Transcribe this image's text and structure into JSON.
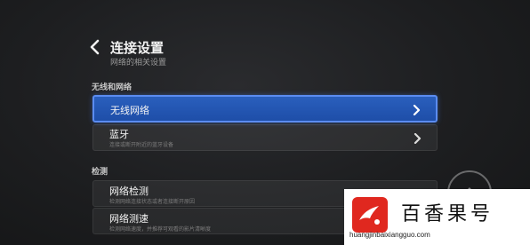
{
  "header": {
    "back_icon": "chevron-left-icon",
    "title": "连接设置",
    "subtitle": "网络的相关设置"
  },
  "sections": [
    {
      "label": "无线和网络",
      "items": [
        {
          "label": "无线网络",
          "description": "",
          "selected": true,
          "icon": "chevron-right-icon"
        },
        {
          "label": "蓝牙",
          "description": "连接或断开附近的蓝牙设备",
          "selected": false,
          "icon": "chevron-right-icon"
        }
      ]
    },
    {
      "label": "检测",
      "items": [
        {
          "label": "网络检测",
          "description": "检测网络连接状态或者连接断开原因",
          "selected": false,
          "icon": "chevron-right-icon"
        },
        {
          "label": "网络测速",
          "description": "检测网络速度，并推荐可观看的影片清晰度",
          "selected": false,
          "icon": "chevron-right-icon"
        }
      ]
    }
  ],
  "watermark": {
    "name": "百香果号",
    "url": "huangjinbaixiangguo.com"
  },
  "colors": {
    "selected_bg": "#2157b5",
    "selected_border": "#5b8cf0",
    "background": "#1b1c1e",
    "brand_red": "#e0281f"
  }
}
